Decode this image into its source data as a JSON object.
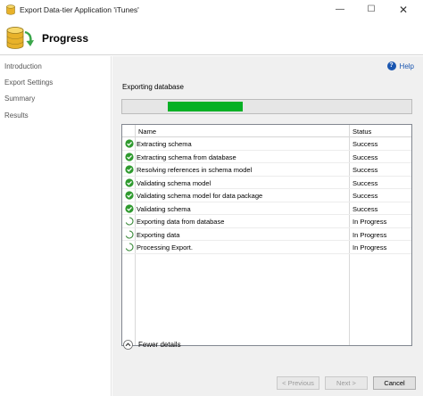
{
  "window": {
    "title": "Export Data-tier Application 'iTunes'",
    "minimize_glyph": "—",
    "maximize_glyph": "☐",
    "close_glyph": "✕"
  },
  "header": {
    "title": "Progress",
    "icon": "database-export-icon"
  },
  "sidebar": {
    "items": [
      {
        "label": "Introduction"
      },
      {
        "label": "Export Settings"
      },
      {
        "label": "Summary"
      },
      {
        "label": "Results"
      }
    ]
  },
  "help": {
    "label": "Help",
    "icon_glyph": "?"
  },
  "main": {
    "section_label": "Exporting database",
    "progress_percent": 26
  },
  "grid": {
    "columns": {
      "name": "Name",
      "status": "Status"
    },
    "rows": [
      {
        "name": "Extracting schema",
        "status": "Success",
        "icon": "success-check-icon"
      },
      {
        "name": "Extracting schema from database",
        "status": "Success",
        "icon": "success-check-icon"
      },
      {
        "name": "Resolving references in schema model",
        "status": "Success",
        "icon": "success-check-icon"
      },
      {
        "name": "Validating schema model",
        "status": "Success",
        "icon": "success-check-icon"
      },
      {
        "name": "Validating schema model for data package",
        "status": "Success",
        "icon": "success-check-icon"
      },
      {
        "name": "Validating schema",
        "status": "Success",
        "icon": "success-check-icon"
      },
      {
        "name": "Exporting data from database",
        "status": "In Progress",
        "icon": "in-progress-spinner-icon"
      },
      {
        "name": "Exporting data",
        "status": "In Progress",
        "icon": "in-progress-spinner-icon"
      },
      {
        "name": "Processing Export.",
        "status": "In Progress",
        "icon": "in-progress-spinner-icon"
      }
    ]
  },
  "details_toggle": {
    "label": "Fewer details"
  },
  "footer": {
    "previous_label": "< Previous",
    "next_label": "Next >",
    "cancel_label": "Cancel"
  },
  "colors": {
    "progress_fill": "#06b025",
    "success": "#2f9a2f",
    "link": "#1a56b0"
  }
}
